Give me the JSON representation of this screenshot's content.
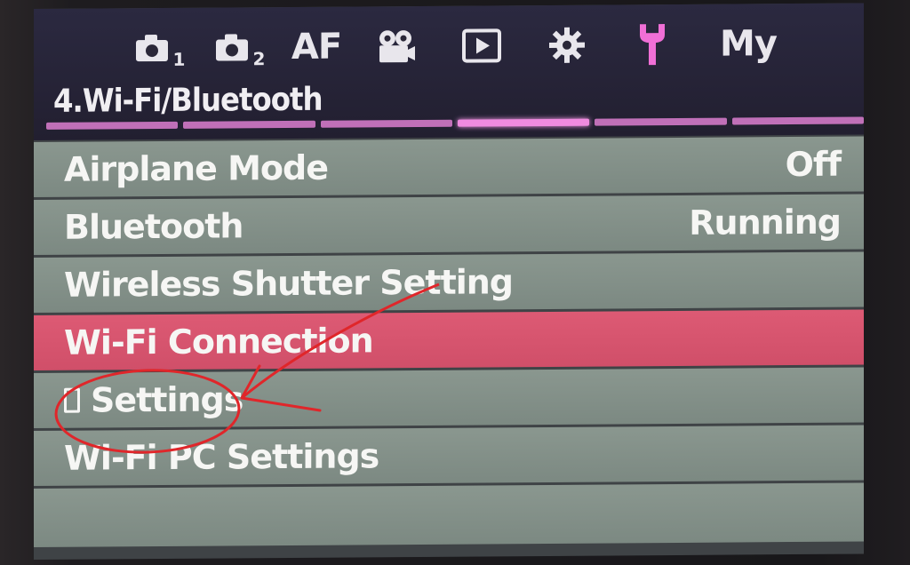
{
  "tabs": [
    {
      "icon": "camera-1-icon",
      "label": "",
      "sub": "1"
    },
    {
      "icon": "camera-2-icon",
      "label": "",
      "sub": "2"
    },
    {
      "icon": "af-icon",
      "label": "AF"
    },
    {
      "icon": "movie-camera-icon",
      "label": ""
    },
    {
      "icon": "playback-icon",
      "label": ""
    },
    {
      "icon": "gear-icon",
      "label": ""
    },
    {
      "icon": "wrench-icon",
      "label": ""
    },
    {
      "icon": "my-menu-icon",
      "label": "My"
    }
  ],
  "active_tab_color": "#f06fd6",
  "section_title": "4.Wi-Fi/Bluetooth",
  "page_indicator": {
    "segments": 6,
    "active_index": 3
  },
  "menu": {
    "items": [
      {
        "label": "Airplane Mode",
        "value": "Off"
      },
      {
        "label": "Bluetooth",
        "value": "Running"
      },
      {
        "label": "Wireless Shutter Setting",
        "value": ""
      },
      {
        "label": "Wi-Fi Connection",
        "value": "",
        "selected": true
      },
      {
        "label": "Settings",
        "value": "",
        "icon": "smartphone-icon"
      },
      {
        "label": "Wi-Fi PC Settings",
        "value": ""
      }
    ]
  },
  "colors": {
    "selected_row": "#d85670",
    "row": "#84918a",
    "header": "#27243a",
    "annotation": "#e0262a"
  }
}
